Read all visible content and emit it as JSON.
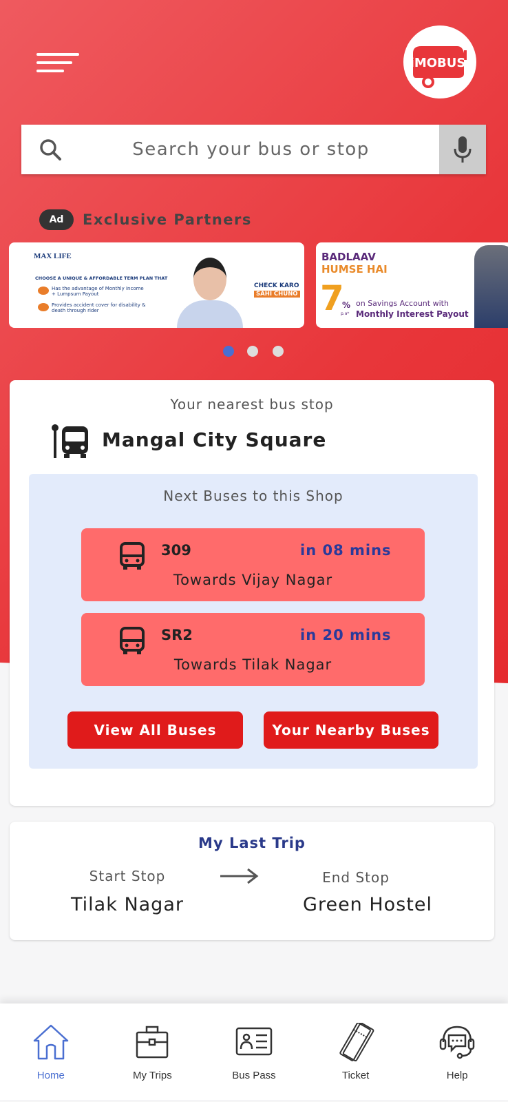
{
  "header": {
    "logo_text": "iMOBUS",
    "search_placeholder": "Search your bus or stop"
  },
  "ads": {
    "badge": "Ad",
    "title": "Exclusive Partners",
    "banner1": {
      "brand": "MAX LIFE",
      "headline": "CHOOSE A UNIQUE & AFFORDABLE TERM PLAN THAT",
      "point1": "Has the advantage of Monthly Income + Lumpsum Payout",
      "point2": "Provides accident cover for disability & death through rider",
      "cta1": "CHECK KARO",
      "cta2": "SAHI CHUNO"
    },
    "banner2": {
      "line1": "BADLAAV",
      "line2": "HUMSE HAI",
      "rate": "7",
      "pct": "%",
      "pa": "p.a*",
      "text1": "on Savings Account with",
      "text2": "Monthly Interest Payout"
    },
    "active_dot": 1,
    "dot_count": 3
  },
  "nearest": {
    "label": "Your nearest bus stop",
    "stop": "Mangal City Square",
    "next_label": "Next Buses to this Shop",
    "buses": [
      {
        "route": "309",
        "eta": "in 08 mins",
        "towards": "Towards Vijay Nagar"
      },
      {
        "route": "SR2",
        "eta": "in 20 mins",
        "towards": "Towards Tilak Nagar"
      }
    ],
    "view_all": "View All Buses",
    "nearby": "Your Nearby Buses"
  },
  "last_trip": {
    "title": "My Last Trip",
    "start_label": "Start Stop",
    "end_label": "End Stop",
    "start": "Tilak Nagar",
    "end": "Green Hostel"
  },
  "nav": {
    "items": [
      {
        "label": "Home",
        "icon": "home-icon",
        "active": true
      },
      {
        "label": "My Trips",
        "icon": "briefcase-icon"
      },
      {
        "label": "Bus Pass",
        "icon": "id-card-icon"
      },
      {
        "label": "Ticket",
        "icon": "ticket-icon"
      },
      {
        "label": "Help",
        "icon": "headset-icon"
      }
    ]
  },
  "colors": {
    "primary": "#e8363a",
    "accent_blue": "#4a6fd1",
    "bus_card": "#ff6b6b",
    "button": "#e01b1b",
    "panel": "#e3ebfb"
  }
}
